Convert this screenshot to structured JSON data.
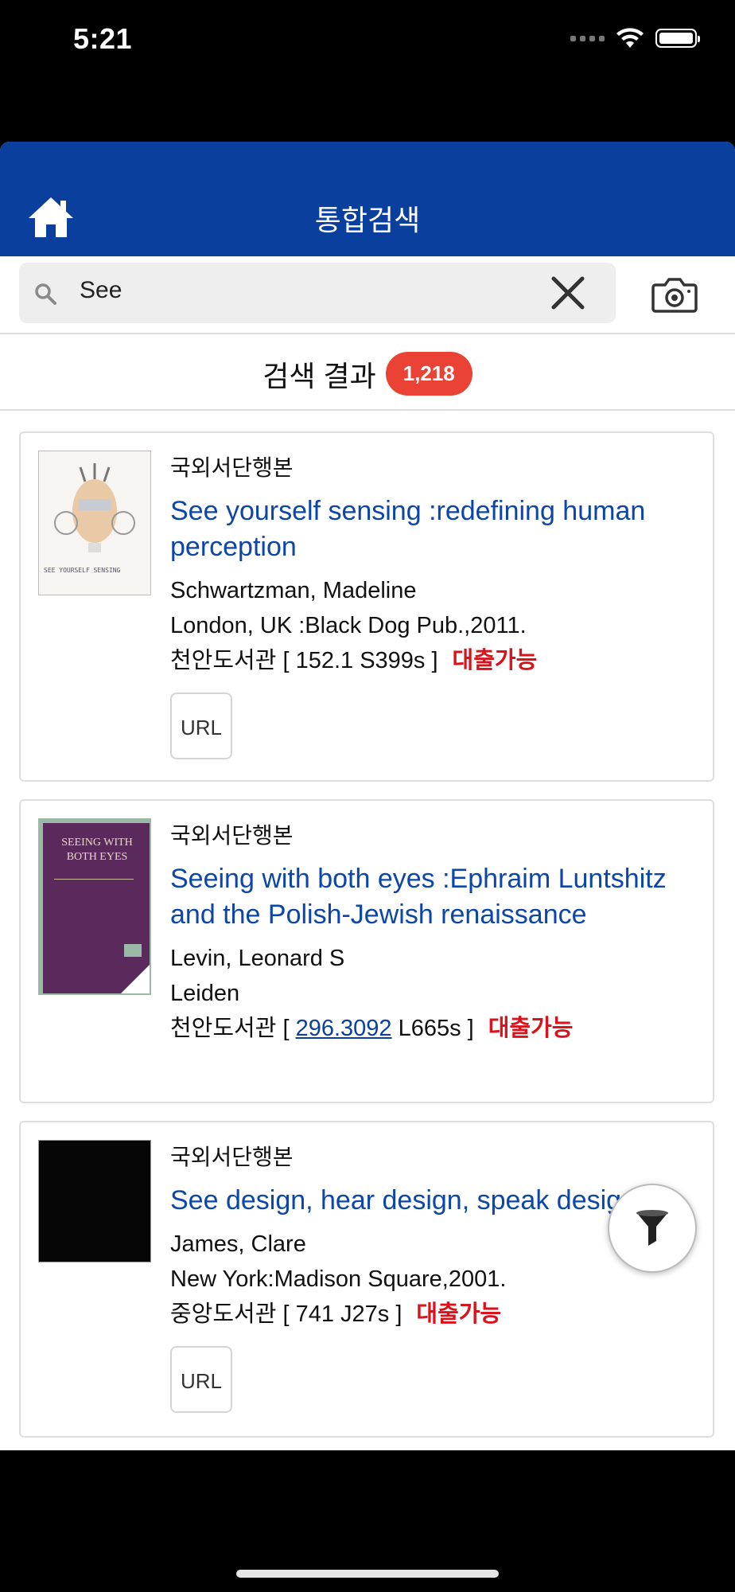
{
  "status": {
    "time": "5:21"
  },
  "header": {
    "title": "통합검색"
  },
  "search": {
    "query": "See"
  },
  "results": {
    "label": "검색 결과",
    "count": "1,218"
  },
  "items": [
    {
      "type": "국외서단행본",
      "title": "See yourself sensing :redefining human perception",
      "author": "Schwartzman, Madeline",
      "publisher": "London, UK :Black Dog Pub.,2011.",
      "location": "천안도서관 [ 152.1 S399s ]",
      "availability": "대출가능",
      "url_label": "URL",
      "cover_text": "SEE YOURSELF SENSING"
    },
    {
      "type": "국외서단행본",
      "title": "Seeing with both eyes :Ephraim Luntshitz and the Polish-Jewish renaissance",
      "author": "Levin, Leonard S",
      "publisher": "Leiden",
      "location_prefix": "천안도서관 [",
      "location_link": "296.3092",
      "location_suffix": "L665s ]",
      "availability": "대출가능",
      "cover_text": "SEEING WITH BOTH EYES"
    },
    {
      "type": "국외서단행본",
      "title": "See design, hear design, speak design",
      "author": "James, Clare",
      "publisher": "New York:Madison Square,2001.",
      "location": "중앙도서관 [ 741 J27s ]",
      "availability": "대출가능",
      "url_label": "URL"
    }
  ],
  "colors": {
    "header": "#0b3f9e",
    "title_link": "#0b46a8",
    "available": "#d9121b",
    "badge": "#ea4335"
  },
  "icons": [
    "home-icon",
    "search-icon",
    "close-icon",
    "camera-icon",
    "filter-icon"
  ]
}
